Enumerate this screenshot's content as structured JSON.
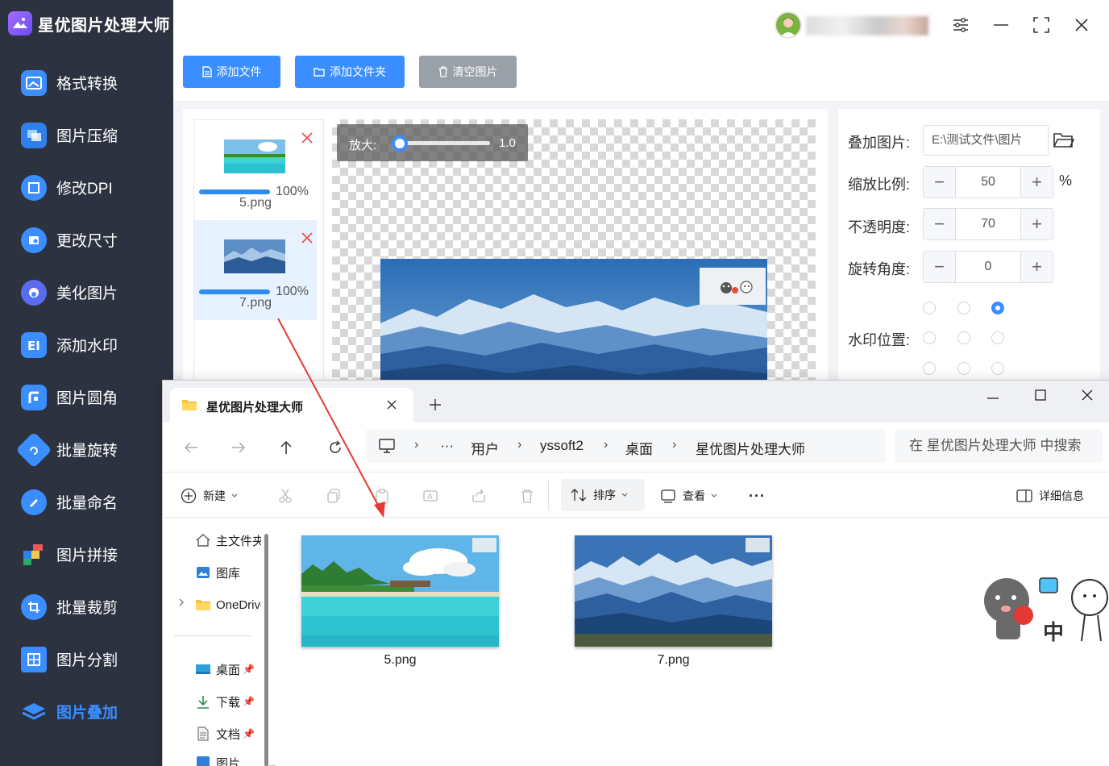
{
  "app": {
    "title": "星优图片处理大师",
    "nav": [
      {
        "label": "格式转换",
        "icon": "image-convert-icon",
        "active": false
      },
      {
        "label": "图片压缩",
        "icon": "image-compress-icon",
        "active": false
      },
      {
        "label": "修改DPI",
        "icon": "dpi-icon",
        "active": false
      },
      {
        "label": "更改尺寸",
        "icon": "resize-icon",
        "active": false
      },
      {
        "label": "美化图片",
        "icon": "beautify-icon",
        "active": false
      },
      {
        "label": "添加水印",
        "icon": "watermark-icon",
        "active": false
      },
      {
        "label": "图片圆角",
        "icon": "round-corner-icon",
        "active": false
      },
      {
        "label": "批量旋转",
        "icon": "rotate-icon",
        "active": false
      },
      {
        "label": "批量命名",
        "icon": "rename-icon",
        "active": false
      },
      {
        "label": "图片拼接",
        "icon": "stitch-icon",
        "active": false
      },
      {
        "label": "批量裁剪",
        "icon": "crop-icon",
        "active": false
      },
      {
        "label": "图片分割",
        "icon": "split-icon",
        "active": false
      },
      {
        "label": "图片叠加",
        "icon": "layers-icon",
        "active": true
      }
    ],
    "toolbar": {
      "add_file": "添加文件",
      "add_folder": "添加文件夹",
      "clear": "清空图片"
    },
    "files": [
      {
        "name": "5.png",
        "progress_label": "100%",
        "progress": 1.0
      },
      {
        "name": "7.png",
        "progress_label": "100%",
        "progress": 1.0
      }
    ],
    "zoom": {
      "label": "放大:",
      "value": "1.0"
    },
    "settings": {
      "overlay_label": "叠加图片:",
      "overlay_path": "E:\\测试文件\\图片",
      "scale_label": "缩放比例:",
      "scale_value": "50",
      "scale_unit": "%",
      "opacity_label": "不透明度:",
      "opacity_value": "70",
      "rotation_label": "旋转角度:",
      "rotation_value": "0",
      "position_label": "水印位置:",
      "position_selected": "top-right"
    },
    "colors": {
      "accent": "#3a8eff",
      "sidebar": "#2c3240",
      "clear_button": "#9aa0a8"
    }
  },
  "explorer": {
    "tab_title": "星优图片处理大师",
    "breadcrumb": [
      "用户",
      "yssoft2",
      "桌面",
      "星优图片处理大师"
    ],
    "ellipsis": "···",
    "search_placeholder": "在 星优图片处理大师 中搜索",
    "commands": {
      "new": "新建",
      "sort": "排序",
      "view": "查看",
      "more": "···",
      "details": "详细信息"
    },
    "nav_items": [
      {
        "label": "主文件夹",
        "icon": "home-icon"
      },
      {
        "label": "图库",
        "icon": "gallery-icon"
      },
      {
        "label": "OneDrive",
        "icon": "folder-icon"
      },
      {
        "label": "桌面",
        "icon": "desktop-icon"
      },
      {
        "label": "下载",
        "icon": "download-icon"
      },
      {
        "label": "文档",
        "icon": "document-icon"
      },
      {
        "label": "图片",
        "icon": "picture-icon"
      }
    ],
    "files": [
      {
        "name": "5.png"
      },
      {
        "name": "7.png"
      }
    ]
  }
}
